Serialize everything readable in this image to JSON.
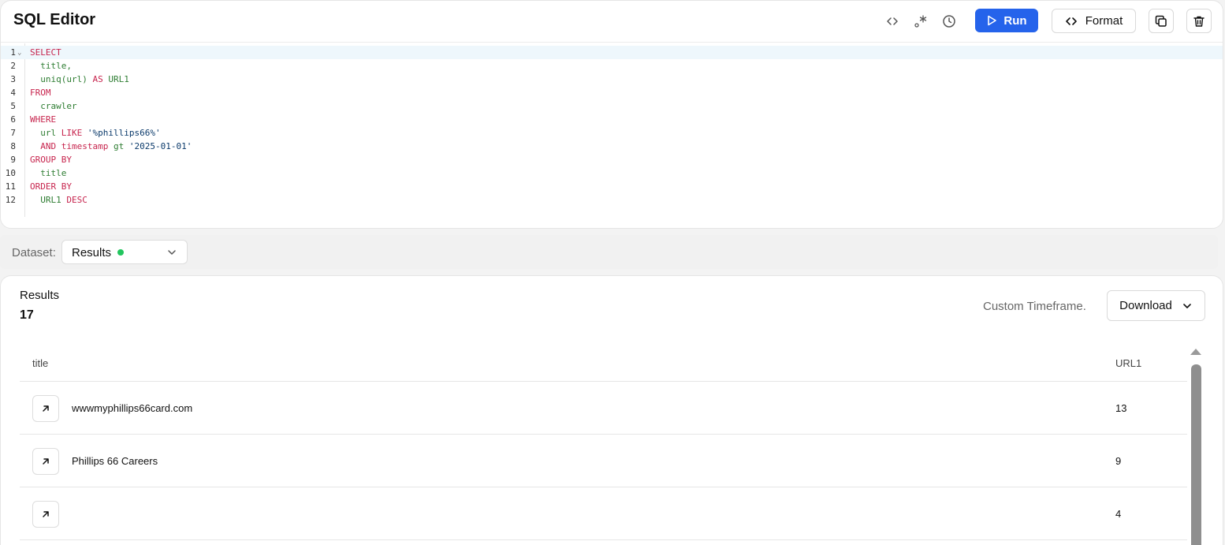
{
  "editor": {
    "title": "SQL Editor",
    "toolbar": {
      "code_icon": "code-brackets-icon",
      "regex_icon": "regex-icon",
      "history_icon": "clock-icon",
      "run_label": "Run",
      "format_label": "Format",
      "copy_icon": "copy-icon",
      "delete_icon": "trash-icon"
    },
    "line_numbers": [
      "1",
      "2",
      "3",
      "4",
      "5",
      "6",
      "7",
      "8",
      "9",
      "10",
      "11",
      "12"
    ],
    "lines": [
      [
        {
          "t": "SELECT",
          "c": "kw"
        }
      ],
      [
        {
          "t": "  title,",
          "c": "fn"
        }
      ],
      [
        {
          "t": "  uniq(url) ",
          "c": "fn"
        },
        {
          "t": "AS",
          "c": "kw"
        },
        {
          "t": " URL1",
          "c": "fn"
        }
      ],
      [
        {
          "t": "FROM",
          "c": "kw"
        }
      ],
      [
        {
          "t": "  crawler",
          "c": "fn"
        }
      ],
      [
        {
          "t": "WHERE",
          "c": "kw"
        }
      ],
      [
        {
          "t": "  url ",
          "c": "fn"
        },
        {
          "t": "LIKE",
          "c": "kw"
        },
        {
          "t": " '%phillips66%'",
          "c": "str"
        }
      ],
      [
        {
          "t": "  AND timestamp",
          "c": "kw"
        },
        {
          "t": " gt ",
          "c": "fn"
        },
        {
          "t": "'2025-01-01'",
          "c": "str"
        }
      ],
      [
        {
          "t": "GROUP BY",
          "c": "kw"
        }
      ],
      [
        {
          "t": "  title",
          "c": "fn"
        }
      ],
      [
        {
          "t": "ORDER BY",
          "c": "kw"
        }
      ],
      [
        {
          "t": "  URL1 ",
          "c": "fn"
        },
        {
          "t": "DESC",
          "c": "kw"
        }
      ]
    ]
  },
  "dataset": {
    "label": "Dataset:",
    "selected": "Results",
    "status_color": "#22c55e"
  },
  "results": {
    "label": "Results",
    "count": "17",
    "timeframe": "Custom Timeframe.",
    "download_label": "Download",
    "columns": [
      "title",
      "URL1"
    ],
    "rows": [
      {
        "title": "wwwmyphillips66card.com",
        "url1": "13"
      },
      {
        "title": "Phillips 66 Careers",
        "url1": "9"
      },
      {
        "title": "",
        "url1": "4"
      }
    ]
  },
  "colors": {
    "accent": "#2563eb",
    "keyword": "#c7254e",
    "identifier": "#2e7d32",
    "string": "#0b3a6b"
  }
}
